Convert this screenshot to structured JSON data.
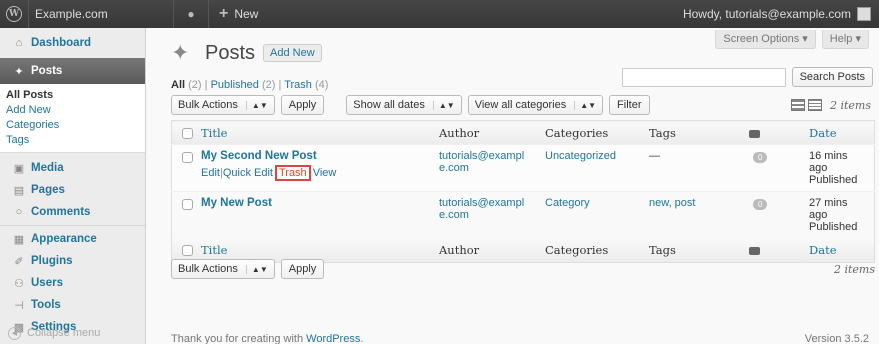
{
  "adminbar": {
    "site_name": "Example.com",
    "new_label": "New",
    "howdy": "Howdy, tutorials@example.com"
  },
  "sidebar": {
    "items": [
      {
        "label": "Dashboard",
        "icon": "dashboard-icon"
      },
      {
        "label": "Posts",
        "icon": "pin-icon"
      },
      {
        "label": "Media",
        "icon": "media-icon"
      },
      {
        "label": "Pages",
        "icon": "pages-icon"
      },
      {
        "label": "Comments",
        "icon": "comments-icon"
      },
      {
        "label": "Appearance",
        "icon": "appearance-icon"
      },
      {
        "label": "Plugins",
        "icon": "plugins-icon"
      },
      {
        "label": "Users",
        "icon": "users-icon"
      },
      {
        "label": "Tools",
        "icon": "tools-icon"
      },
      {
        "label": "Settings",
        "icon": "settings-icon"
      }
    ],
    "submenu": [
      "All Posts",
      "Add New",
      "Categories",
      "Tags"
    ],
    "collapse": "Collapse menu"
  },
  "header": {
    "screen_options": "Screen Options",
    "help": "Help",
    "title": "Posts",
    "add_new": "Add New"
  },
  "filters": {
    "all": "All",
    "all_count": "(2)",
    "published": "Published",
    "published_count": "(2)",
    "trash": "Trash",
    "trash_count": "(4)",
    "sep": "|"
  },
  "search": {
    "button": "Search Posts"
  },
  "tablenav": {
    "bulk_actions": "Bulk Actions",
    "apply": "Apply",
    "dates": "Show all dates",
    "categories": "View all categories",
    "filter": "Filter",
    "items": "2 items"
  },
  "table": {
    "columns": {
      "title": "Title",
      "author": "Author",
      "categories": "Categories",
      "tags": "Tags",
      "date": "Date"
    },
    "rows": [
      {
        "title": "My Second New Post",
        "actions": {
          "edit": "Edit",
          "quick_edit": "Quick Edit",
          "trash": "Trash",
          "view": "View"
        },
        "author_1": "tutorials@exampl",
        "author_2": "e.com",
        "categories": "Uncategorized",
        "tags": "—",
        "comments": "0",
        "date_1": "16 mins",
        "date_2": "ago",
        "date_3": "Published"
      },
      {
        "title": "My New Post",
        "author_1": "tutorials@exampl",
        "author_2": "e.com",
        "categories": "Category",
        "tags": "new, post",
        "comments": "0",
        "date_1": "27 mins",
        "date_2": "ago",
        "date_3": "Published"
      }
    ]
  },
  "footer": {
    "thanks": "Thank you for creating with",
    "wordpress": "WordPress",
    "period": ".",
    "version": "Version 3.5.2"
  },
  "colors": {
    "link": "#21759b",
    "highlight": "#d44"
  }
}
